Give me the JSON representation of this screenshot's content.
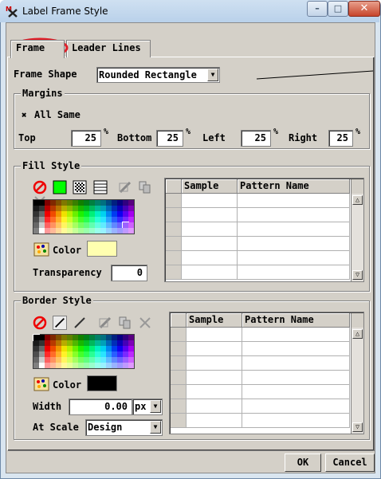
{
  "window": {
    "title": "Label Frame Style",
    "minimize": "–",
    "maximize": "□",
    "close": "✕"
  },
  "tabs": [
    {
      "label": "Frame",
      "active": true
    },
    {
      "label": "Leader Lines",
      "active": false
    }
  ],
  "frame_shape": {
    "label": "Frame Shape",
    "value": "Rounded Rectangle"
  },
  "margins": {
    "title": "Margins",
    "all_same": {
      "label": "All Same",
      "checked": true
    },
    "top": {
      "label": "Top",
      "value": "25",
      "unit": "%"
    },
    "bottom": {
      "label": "Bottom",
      "value": "25",
      "unit": "%"
    },
    "left": {
      "label": "Left",
      "value": "25",
      "unit": "%"
    },
    "right": {
      "label": "Right",
      "value": "25",
      "unit": "%"
    }
  },
  "fill_style": {
    "title": "Fill Style",
    "color_label": "Color",
    "color_value": "#ffffb0",
    "transparency_label": "Transparency",
    "transparency_value": "0",
    "table_headers": [
      "Sample",
      "Pattern Name"
    ]
  },
  "border_style": {
    "title": "Border Style",
    "color_label": "Color",
    "color_value": "#000000",
    "width_label": "Width",
    "width_value": "0.00",
    "width_unit": "px",
    "at_scale_label": "At Scale",
    "at_scale_value": "Design",
    "table_headers": [
      "Sample",
      "Pattern Name"
    ]
  },
  "buttons": {
    "ok": "OK",
    "cancel": "Cancel"
  },
  "colors": {
    "dialog": "#d4d0c8",
    "fill_selected": "#00ff00",
    "highlight_ring": "#e0202a"
  }
}
